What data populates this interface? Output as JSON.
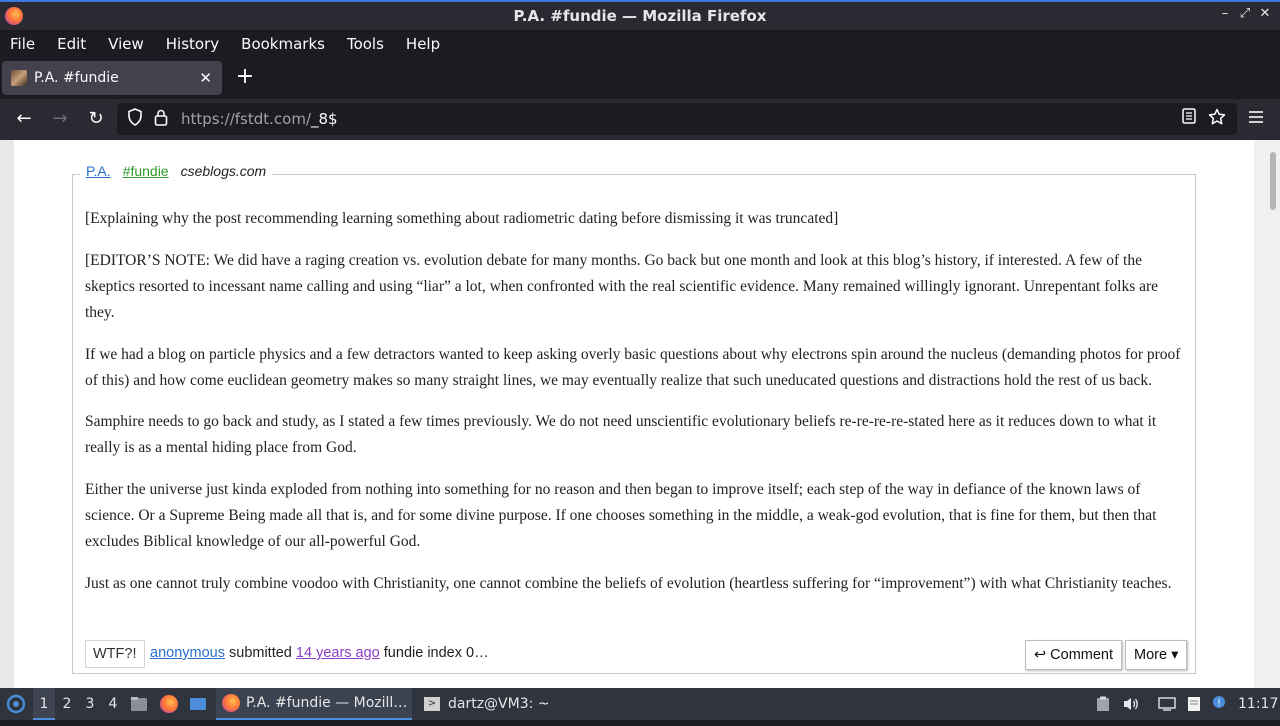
{
  "window": {
    "title": "P.A. #fundie — Mozilla Firefox",
    "controls": {
      "minimize": "–",
      "maximize": "⤢",
      "close": "✕"
    }
  },
  "menu": [
    "File",
    "Edit",
    "View",
    "History",
    "Bookmarks",
    "Tools",
    "Help"
  ],
  "tab": {
    "title": "P.A. #fundie",
    "close": "✕",
    "new_tab": "+"
  },
  "navbar": {
    "back": "←",
    "forward": "→",
    "reload": "↻",
    "url_host": "https://fstdt.com/",
    "url_path": "_8$"
  },
  "post": {
    "author": "P.A.",
    "tag": "#fundie",
    "source": "cseblogs.com",
    "paragraphs": [
      "[Explaining why the post recommending learning something about radiometric dating before dismissing it was truncated]",
      "[EDITOR’S NOTE: We did have a raging creation vs. evolution debate for many months. Go back but one month and look at this blog’s history, if interested. A few of the skeptics resorted to incessant name calling and using “liar” a lot, when confronted with the real scientific evidence. Many remained willingly ignorant. Unrepentant folks are they.",
      "If we had a blog on particle physics and a few detractors wanted to keep asking overly basic questions about why electrons spin around the nucleus (demanding photos for proof of this) and how come euclidean geometry makes so many straight lines, we may eventually realize that such uneducated questions and distractions hold the rest of us back.",
      "Samphire needs to go back and study, as I stated a few times previously. We do not need unscientific evolutionary beliefs re-re-re-re-stated here as it reduces down to what it really is as a mental hiding place from God.",
      "Either the universe just kinda exploded from nothing into something for no reason and then began to improve itself; each step of the way in defiance of the known laws of science. Or a Supreme Being made all that is, and for some divine purpose. If one chooses something in the middle, a weak-god evolution, that is fine for them, but then that excludes Biblical knowledge of our all-powerful God.",
      "Just as one cannot truly combine voodoo with Christianity, one cannot combine the beliefs of evolution (heartless suffering for “improvement”) with what Christianity teaches."
    ],
    "footer": {
      "wtf": "WTF?!",
      "submitter": "anonymous",
      "submitted_word": "submitted",
      "ago": "14 years ago",
      "index": "fundie index 0…",
      "comment": "↩ Comment",
      "more": "More ▾"
    }
  },
  "taskbar": {
    "workspaces": [
      "1",
      "2",
      "3",
      "4"
    ],
    "firefox_task": "P.A. #fundie — Mozill…",
    "terminal_task": "dartz@VM3: ~",
    "clock": "11:17"
  }
}
